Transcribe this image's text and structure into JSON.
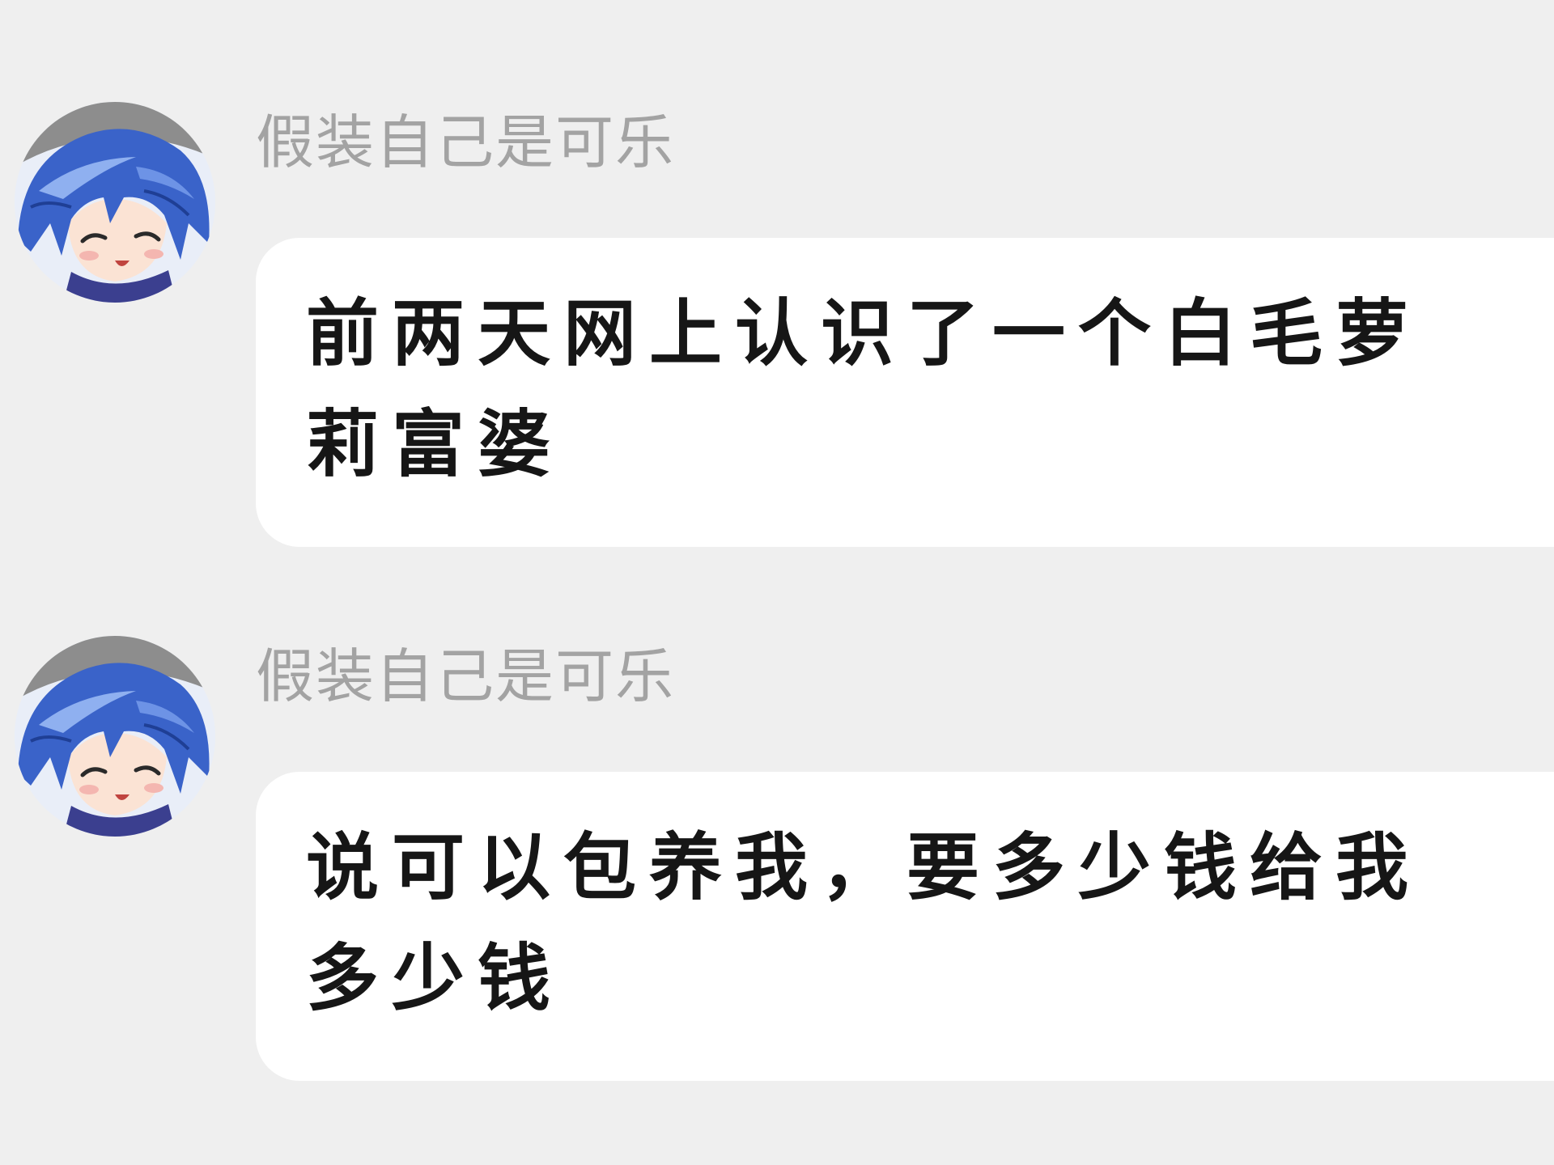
{
  "messages": [
    {
      "sender": "假装自己是可乐",
      "avatar_icon": "anime-avatar-icon",
      "text": "前两天网上认识了一个白毛萝莉富婆"
    },
    {
      "sender": "假装自己是可乐",
      "avatar_icon": "anime-avatar-icon",
      "text": "说可以包养我，要多少钱给我多少钱"
    }
  ],
  "colors": {
    "background": "#efefef",
    "bubble": "#ffffff",
    "sender_name": "#a3a3a3",
    "message_text": "#161616",
    "avatar_hair": "#3a63c9"
  }
}
